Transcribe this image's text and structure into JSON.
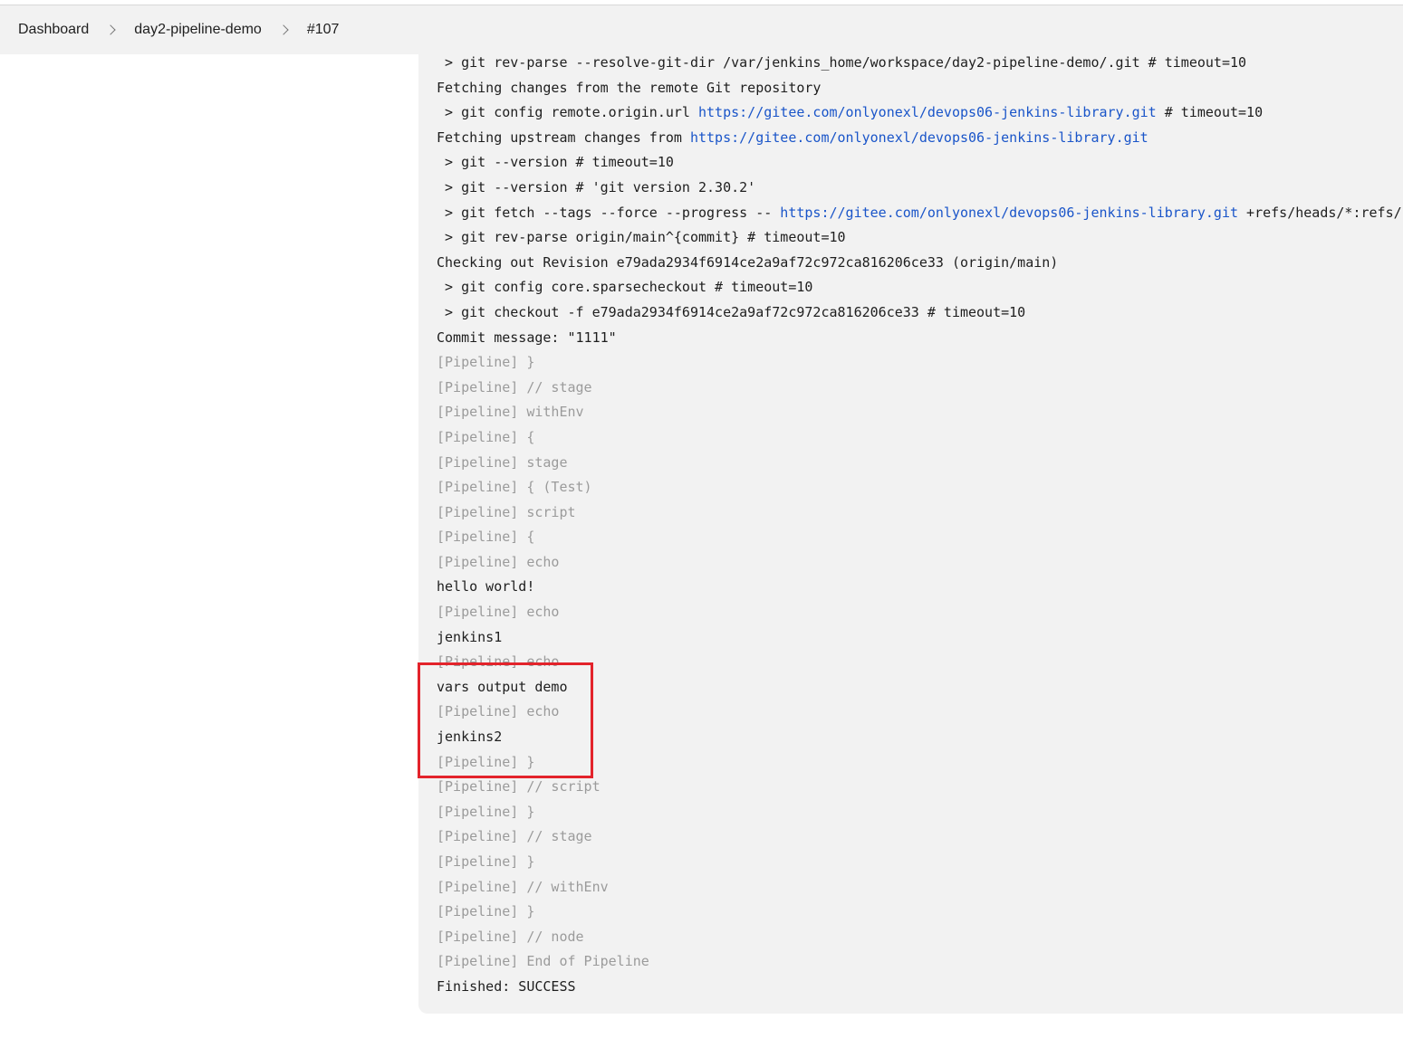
{
  "breadcrumb": {
    "items": [
      "Dashboard",
      "day2-pipeline-demo",
      "#107"
    ]
  },
  "colors": {
    "pipeline_text": "#9b9b9b",
    "link": "#1a55c9",
    "highlight_border": "#e3232b",
    "console_bg": "#f2f2f2"
  },
  "console": {
    "lines": [
      {
        "type": "cmd",
        "parts": [
          {
            "t": " > git rev-parse --resolve-git-dir /var/jenkins_home/workspace/day2-pipeline-demo/.git # timeout=10"
          }
        ]
      },
      {
        "type": "text",
        "parts": [
          {
            "t": "Fetching changes from the remote Git repository"
          }
        ]
      },
      {
        "type": "cmd",
        "parts": [
          {
            "t": " > git config remote.origin.url "
          },
          {
            "t": "https://gitee.com/onlyonexl/devops06-jenkins-library.git",
            "link": true
          },
          {
            "t": " # timeout=10"
          }
        ]
      },
      {
        "type": "text",
        "parts": [
          {
            "t": "Fetching upstream changes from "
          },
          {
            "t": "https://gitee.com/onlyonexl/devops06-jenkins-library.git",
            "link": true
          }
        ]
      },
      {
        "type": "cmd",
        "parts": [
          {
            "t": " > git --version # timeout=10"
          }
        ]
      },
      {
        "type": "cmd",
        "parts": [
          {
            "t": " > git --version # 'git version 2.30.2'"
          }
        ]
      },
      {
        "type": "cmd",
        "parts": [
          {
            "t": " > git fetch --tags --force --progress -- "
          },
          {
            "t": "https://gitee.com/onlyonexl/devops06-jenkins-library.git",
            "link": true
          },
          {
            "t": " +refs/heads/*:refs/re"
          }
        ]
      },
      {
        "type": "cmd",
        "parts": [
          {
            "t": " > git rev-parse origin/main^{commit} # timeout=10"
          }
        ]
      },
      {
        "type": "text",
        "parts": [
          {
            "t": "Checking out Revision e79ada2934f6914ce2a9af72c972ca816206ce33 (origin/main)"
          }
        ]
      },
      {
        "type": "cmd",
        "parts": [
          {
            "t": " > git config core.sparsecheckout # timeout=10"
          }
        ]
      },
      {
        "type": "cmd",
        "parts": [
          {
            "t": " > git checkout -f e79ada2934f6914ce2a9af72c972ca816206ce33 # timeout=10"
          }
        ]
      },
      {
        "type": "text",
        "parts": [
          {
            "t": "Commit message: \"1111\""
          }
        ]
      },
      {
        "type": "pipeline",
        "parts": [
          {
            "t": "[Pipeline] }"
          }
        ]
      },
      {
        "type": "pipeline",
        "parts": [
          {
            "t": "[Pipeline] // stage"
          }
        ]
      },
      {
        "type": "pipeline",
        "parts": [
          {
            "t": "[Pipeline] withEnv"
          }
        ]
      },
      {
        "type": "pipeline",
        "parts": [
          {
            "t": "[Pipeline] {"
          }
        ]
      },
      {
        "type": "pipeline",
        "parts": [
          {
            "t": "[Pipeline] stage"
          }
        ]
      },
      {
        "type": "pipeline",
        "parts": [
          {
            "t": "[Pipeline] { (Test)"
          }
        ]
      },
      {
        "type": "pipeline",
        "parts": [
          {
            "t": "[Pipeline] script"
          }
        ]
      },
      {
        "type": "pipeline",
        "parts": [
          {
            "t": "[Pipeline] {"
          }
        ]
      },
      {
        "type": "pipeline",
        "parts": [
          {
            "t": "[Pipeline] echo"
          }
        ]
      },
      {
        "type": "text",
        "parts": [
          {
            "t": "hello world!"
          }
        ]
      },
      {
        "type": "pipeline",
        "parts": [
          {
            "t": "[Pipeline] echo"
          }
        ]
      },
      {
        "type": "text",
        "parts": [
          {
            "t": "jenkins1"
          }
        ]
      },
      {
        "type": "pipeline",
        "parts": [
          {
            "t": "[Pipeline] echo"
          }
        ]
      },
      {
        "type": "text",
        "parts": [
          {
            "t": "vars output demo"
          }
        ]
      },
      {
        "type": "pipeline",
        "parts": [
          {
            "t": "[Pipeline] echo"
          }
        ]
      },
      {
        "type": "text",
        "parts": [
          {
            "t": "jenkins2"
          }
        ]
      },
      {
        "type": "pipeline",
        "parts": [
          {
            "t": "[Pipeline] }"
          }
        ]
      },
      {
        "type": "pipeline",
        "parts": [
          {
            "t": "[Pipeline] // script"
          }
        ]
      },
      {
        "type": "pipeline",
        "parts": [
          {
            "t": "[Pipeline] }"
          }
        ]
      },
      {
        "type": "pipeline",
        "parts": [
          {
            "t": "[Pipeline] // stage"
          }
        ]
      },
      {
        "type": "pipeline",
        "parts": [
          {
            "t": "[Pipeline] }"
          }
        ]
      },
      {
        "type": "pipeline",
        "parts": [
          {
            "t": "[Pipeline] // withEnv"
          }
        ]
      },
      {
        "type": "pipeline",
        "parts": [
          {
            "t": "[Pipeline] }"
          }
        ]
      },
      {
        "type": "pipeline",
        "parts": [
          {
            "t": "[Pipeline] // node"
          }
        ]
      },
      {
        "type": "pipeline",
        "parts": [
          {
            "t": "[Pipeline] End of Pipeline"
          }
        ]
      },
      {
        "type": "text",
        "parts": [
          {
            "t": "Finished: SUCCESS"
          }
        ]
      }
    ]
  }
}
